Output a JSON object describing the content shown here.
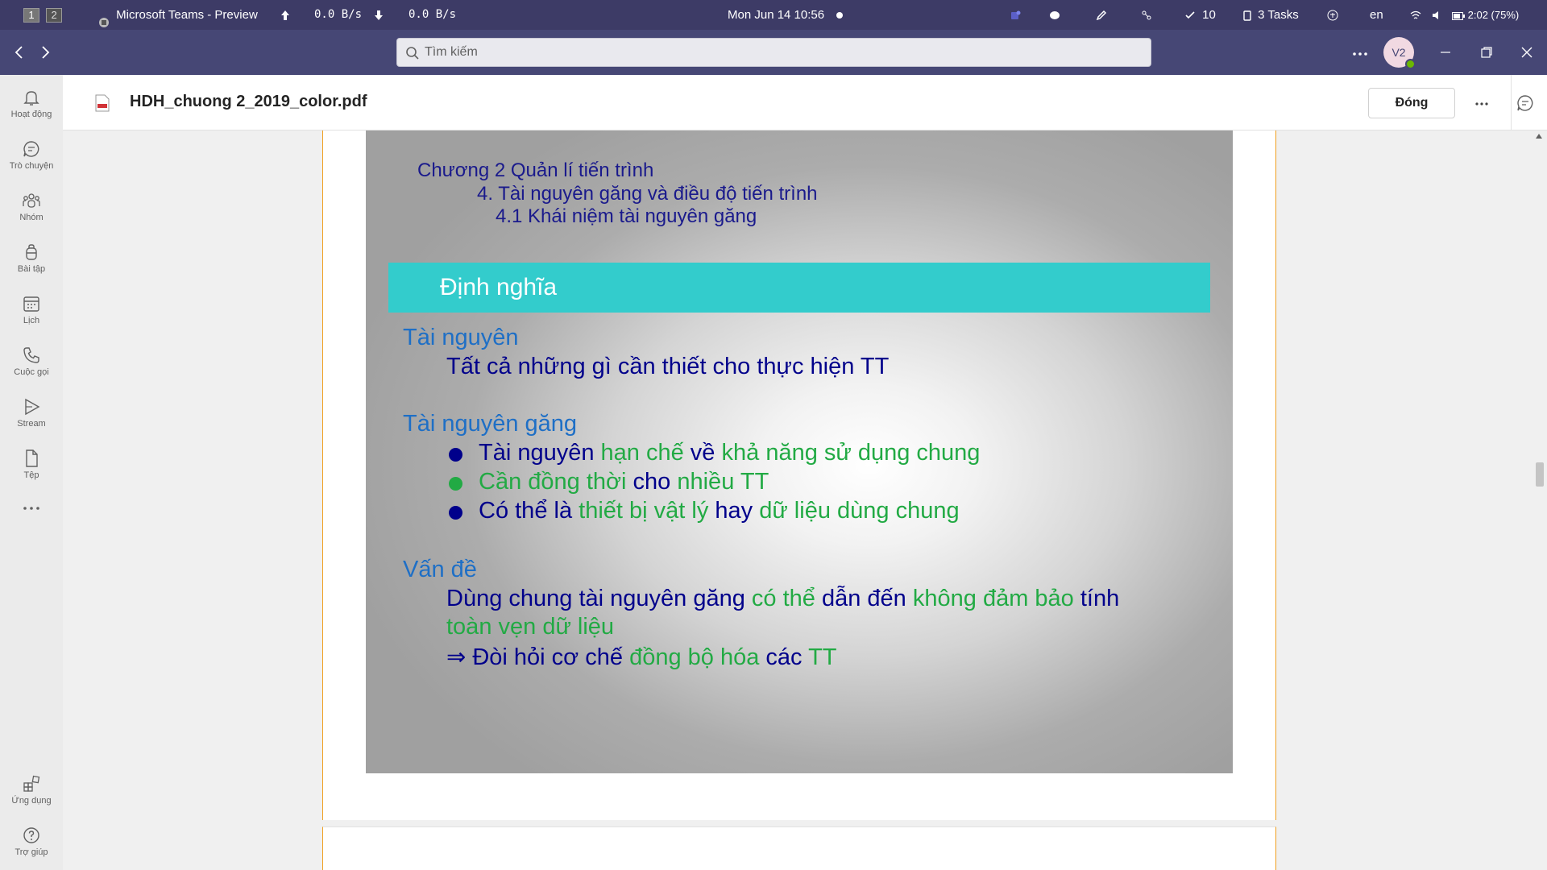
{
  "system_bar": {
    "workspaces": [
      "1",
      "2"
    ],
    "active_window": "Microsoft Teams - Preview",
    "upload_speed": "0.0  B/s",
    "download_speed": "0.0  B/s",
    "datetime": "Mon Jun 14  10:56",
    "tray_count": "10",
    "tasks": "3 Tasks",
    "language": "en",
    "battery": "2:02 (75%)"
  },
  "teams": {
    "search_placeholder": "Tìm kiếm",
    "avatar_initials": "V2"
  },
  "rail": [
    {
      "label": "Hoạt động",
      "icon": "bell-icon"
    },
    {
      "label": "Trò chuyện",
      "icon": "chat-icon"
    },
    {
      "label": "Nhóm",
      "icon": "teams-icon"
    },
    {
      "label": "Bài tập",
      "icon": "backpack-icon"
    },
    {
      "label": "Lịch",
      "icon": "calendar-icon"
    },
    {
      "label": "Cuộc gọi",
      "icon": "phone-icon"
    },
    {
      "label": "Stream",
      "icon": "stream-icon"
    },
    {
      "label": "Tệp",
      "icon": "file-icon"
    },
    {
      "label": "...",
      "icon": "more-icon"
    },
    {
      "label": "Ứng dụng",
      "icon": "apps-icon"
    },
    {
      "label": "Trợ giúp",
      "icon": "help-icon"
    }
  ],
  "document": {
    "file_name": "HDH_chuong 2_2019_color.pdf",
    "close_label": "Đóng",
    "more_label": "···"
  },
  "slide": {
    "chapter": "Chương 2 Quản lí tiến trình",
    "section": "4. Tài nguyên găng và điều độ tiến trình",
    "subsection": "4.1 Khái niệm tài nguyên găng",
    "band_title": "Định nghĩa",
    "resource_heading": "Tài nguyên",
    "resource_def": "Tất cả những gì cần thiết cho thực hiện TT",
    "critical_heading": "Tài nguyên găng",
    "bullets": [
      [
        {
          "t": "Tài nguyên ",
          "c": "n"
        },
        {
          "t": "hạn chế",
          "c": "g"
        },
        {
          "t": " về ",
          "c": "n"
        },
        {
          "t": "khả năng sử dụng chung",
          "c": "g"
        }
      ],
      [
        {
          "t": "Cần đồng thời",
          "c": "g"
        },
        {
          "t": " cho ",
          "c": "n"
        },
        {
          "t": "nhiều TT",
          "c": "g"
        }
      ],
      [
        {
          "t": "Có thể là ",
          "c": "n"
        },
        {
          "t": "thiết bị vật lý",
          "c": "g"
        },
        {
          "t": " hay ",
          "c": "n"
        },
        {
          "t": "dữ liệu dùng chung",
          "c": "g"
        }
      ]
    ],
    "bullet_colors": [
      "#00008b",
      "#22aa44",
      "#00008b"
    ],
    "issue_heading": "Vấn đề",
    "issue_line1": [
      {
        "t": "Dùng chung tài nguyên găng ",
        "c": "n"
      },
      {
        "t": "có thể",
        "c": "g"
      },
      {
        "t": " dẫn đến ",
        "c": "n"
      },
      {
        "t": "không đảm bảo",
        "c": "g"
      },
      {
        "t": " tính",
        "c": "n"
      }
    ],
    "issue_line2": [
      {
        "t": "toàn vẹn dữ liệu",
        "c": "g"
      }
    ],
    "issue_line3": [
      {
        "t": "⇒ Đòi hỏi cơ chế ",
        "c": "n"
      },
      {
        "t": "đồng bộ hóa",
        "c": "g"
      },
      {
        "t": " các ",
        "c": "n"
      },
      {
        "t": "TT",
        "c": "g"
      }
    ]
  },
  "colors": {
    "teams_purple": "#464775",
    "system_bar": "#3d3b66",
    "band_cyan": "#33cccc",
    "heading_blue": "#1e6fc6",
    "text_navy": "#00008b",
    "text_green": "#22aa44"
  }
}
